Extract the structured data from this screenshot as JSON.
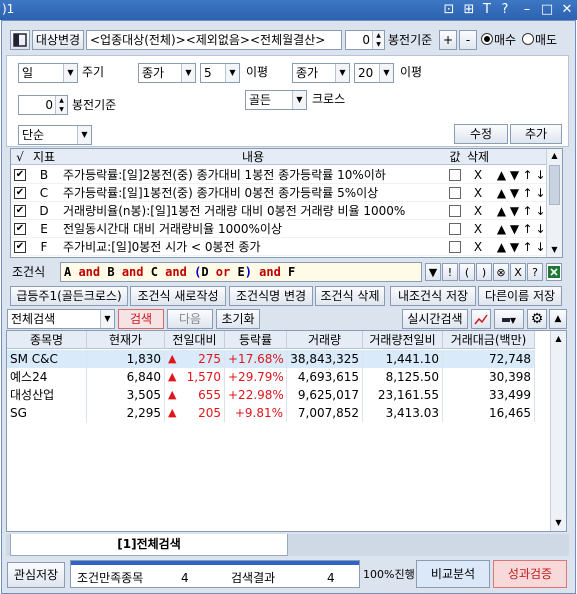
{
  "titlebar": {
    "title": ")1",
    "icons": [
      "layout-icon",
      "pin-icon",
      "text-icon",
      "help-icon",
      "minimize-icon",
      "maximize-icon",
      "close-icon"
    ],
    "icon_glyphs": [
      "⊡",
      "⊞",
      "T",
      "?",
      "–",
      "□",
      "✕"
    ]
  },
  "toolbar": {
    "target_change": "대상변경",
    "target_text": "<업종대상(전체)><제외없음><전체월결산>",
    "bong_value": "0",
    "bong_label": "봉전기준",
    "plus": "+",
    "minus": "-",
    "buy": "매수",
    "sell": "매도"
  },
  "settings": {
    "period_select": "일",
    "period_label": "주기",
    "bong_value": "0",
    "bong_label": "봉전기준",
    "ma1_field": "종가",
    "ma1_period": "5",
    "ma1_label": "이평",
    "ma2_field": "종가",
    "ma2_period": "20",
    "ma2_label": "이평",
    "cross_select": "골든",
    "cross_label": "크로스",
    "mode_select": "단순",
    "modify_button": "수정",
    "add_button": "추가"
  },
  "conditions": {
    "headers": {
      "check": "√",
      "index": "지표",
      "content": "내용",
      "value": "값",
      "delete": "삭제"
    },
    "rows": [
      {
        "checked": true,
        "id": "B",
        "content": "주가등락률:[일]2봉전(중) 종가대비 1봉전 종가등락률 10%이하",
        "del": "X"
      },
      {
        "checked": true,
        "id": "C",
        "content": "주가등락률:[일]1봉전(중) 종가대비 0봉전 종가등락률 5%이상",
        "del": "X"
      },
      {
        "checked": true,
        "id": "D",
        "content": "거래량비율(n봉):[일]1봉전 거래량 대비 0봉전 거래량 비율 1000%",
        "del": "X"
      },
      {
        "checked": true,
        "id": "E",
        "content": "전일동시간대 대비 거래량비율 1000%이상",
        "del": "X"
      },
      {
        "checked": true,
        "id": "F",
        "content": "주가비교:[일]0봉전 시가 < 0봉전 종가",
        "del": "X"
      }
    ],
    "arrow_glyphs": [
      "▲",
      "▼",
      "↑",
      "↓"
    ]
  },
  "formula": {
    "label": "조건식",
    "tokens": [
      {
        "t": "A",
        "c": "#000"
      },
      {
        "t": " and ",
        "c": "#c00000"
      },
      {
        "t": "B",
        "c": "#000"
      },
      {
        "t": " and ",
        "c": "#c00000"
      },
      {
        "t": "C",
        "c": "#000"
      },
      {
        "t": " and ",
        "c": "#c00000"
      },
      {
        "t": "(",
        "c": "#0000c0"
      },
      {
        "t": "D",
        "c": "#000"
      },
      {
        "t": " or ",
        "c": "#c00000"
      },
      {
        "t": "E",
        "c": "#000"
      },
      {
        "t": ")",
        "c": "#0000c0"
      },
      {
        "t": " and ",
        "c": "#c00000"
      },
      {
        "t": "F",
        "c": "#000"
      }
    ],
    "op_buttons": [
      "▼",
      "!",
      "(",
      ")",
      "⊗",
      "X",
      "?"
    ]
  },
  "actions": {
    "b1": "급등주1(골든크로스)",
    "b2": "조건식 새로작성",
    "b3": "조건식명 변경",
    "b4": "조건식 삭제",
    "b5": "내조건식 저장",
    "b6": "다른이름 저장"
  },
  "search": {
    "scope_select": "전체검색",
    "search": "검색",
    "next": "다음",
    "reset": "초기화",
    "realtime": "실시간검색"
  },
  "results": {
    "headers": [
      "종목명",
      "현재가",
      "전일대비",
      "등락률",
      "거래량",
      "거래량전일비",
      "거래대금(백만)"
    ],
    "rows": [
      {
        "name": "SM C&C",
        "price": "1,830",
        "change": "275",
        "rate": "+17.68%",
        "volume": "38,843,325",
        "vol_ratio": "1,441.10",
        "amount": "72,748"
      },
      {
        "name": "예스24",
        "price": "6,840",
        "change": "1,570",
        "rate": "+29.79%",
        "volume": "4,693,615",
        "vol_ratio": "8,125.50",
        "amount": "30,398"
      },
      {
        "name": "대성산업",
        "price": "3,505",
        "change": "655",
        "rate": "+22.98%",
        "volume": "9,625,017",
        "vol_ratio": "23,161.55",
        "amount": "33,499"
      },
      {
        "name": "SG",
        "price": "2,295",
        "change": "205",
        "rate": "+9.81%",
        "volume": "7,007,852",
        "vol_ratio": "3,413.03",
        "amount": "16,465"
      }
    ]
  },
  "tab": {
    "label": "[1]전체검색"
  },
  "footer": {
    "save": "관심저장",
    "cond_count_label": "조건만족종목",
    "cond_count": "4",
    "result_label": "검색결과",
    "result_count": "4",
    "progress": "100%진행",
    "progress_value": 100,
    "compare": "비교분석",
    "verify": "성과검증"
  }
}
